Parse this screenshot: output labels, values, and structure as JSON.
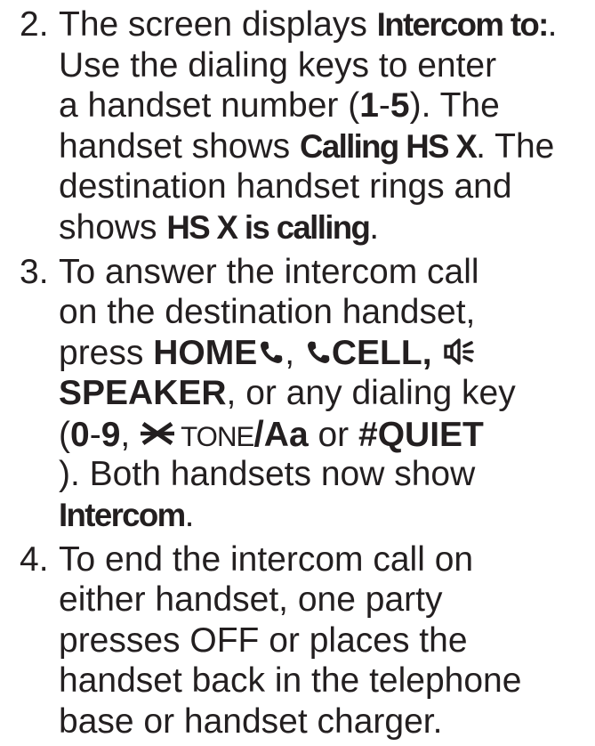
{
  "colors": {
    "text": "#231f20",
    "background": "#ffffff"
  },
  "icons": {
    "home_key": "phone-icon",
    "cell_key": "phone-icon",
    "speaker_key": "speaker-icon",
    "tone_key": "star-key-icon"
  },
  "steps": [
    {
      "number": "2.",
      "lines": [
        [
          "The screen displays ",
          "Intercom to:",
          "."
        ],
        [
          "Use the dialing keys to enter"
        ],
        [
          "a handset number (",
          "1",
          "-",
          "5",
          "). The"
        ],
        [
          "handset shows ",
          "Calling HS X",
          ". The"
        ],
        [
          "destination handset rings and"
        ],
        [
          "shows ",
          "HS X is calling",
          "."
        ]
      ]
    },
    {
      "number": "3.",
      "lines": [
        [
          "To answer the intercom call"
        ],
        [
          "on the destination handset,"
        ],
        [
          "press ",
          "HOME",
          ", ",
          "CELL,"
        ],
        [
          "SPEAKER",
          ", or any dialing key"
        ],
        [
          "(",
          "0",
          "-",
          "9",
          ", ",
          "TONE",
          "/",
          "Aa",
          " or ",
          "#QUIET"
        ],
        [
          "). Both handsets now show"
        ],
        [
          "Intercom",
          "."
        ]
      ]
    },
    {
      "number": "4.",
      "lines": [
        [
          "To end the intercom call on"
        ],
        [
          "either handset, one party"
        ],
        [
          "presses OFF or places the"
        ],
        [
          "handset back in the telephone"
        ],
        [
          "base or handset charger."
        ]
      ]
    }
  ]
}
